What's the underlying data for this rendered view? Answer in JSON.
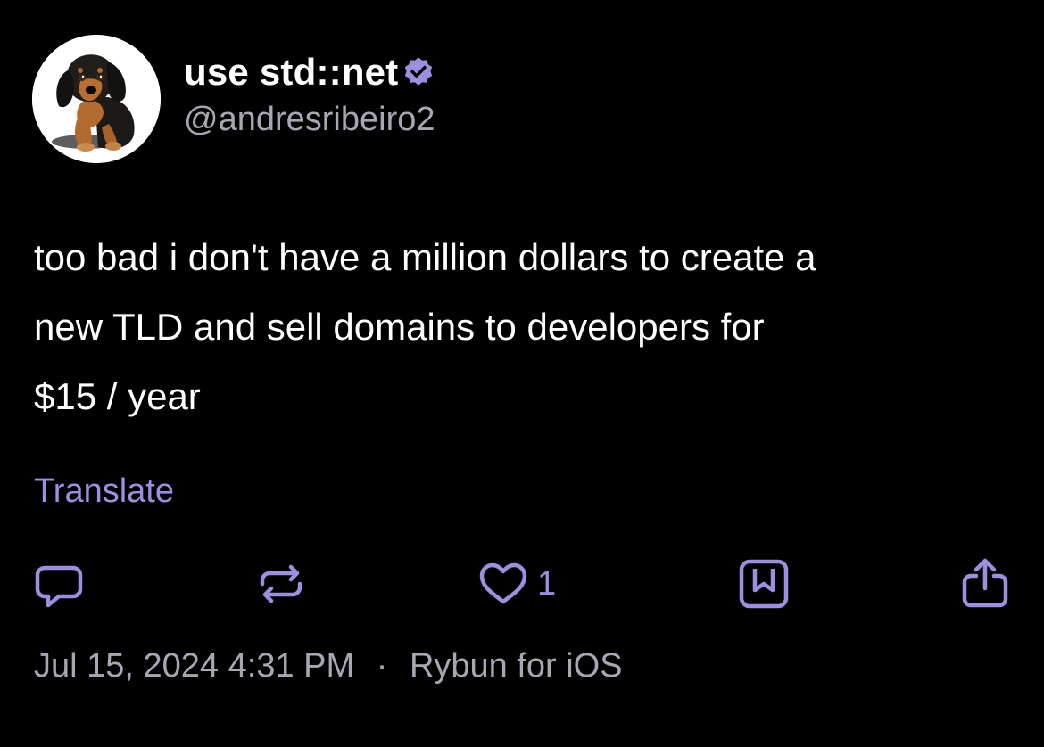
{
  "post": {
    "author": {
      "display_name": "use std::net",
      "handle": "@andresribeiro2",
      "verified": true,
      "avatar_icon": "dachshund-puppy-avatar"
    },
    "text_lines": [
      "too bad i don't have a million dollars to create a",
      "new TLD and sell domains to developers for",
      "$15 / year"
    ],
    "translate_label": "Translate",
    "actions": {
      "reply_icon": "chat-bubble-icon",
      "repost_icon": "repost-arrows-icon",
      "like_icon": "heart-icon",
      "like_count": "1",
      "bookmark_icon": "bookmark-icon",
      "share_icon": "share-icon"
    },
    "meta": {
      "date": "Jul 15, 2024",
      "time": "4:31 PM",
      "separator": "·",
      "client": "Rybun for iOS"
    }
  },
  "colors": {
    "background": "#000000",
    "text": "#ffffff",
    "secondary_text": "#a7a7b3",
    "accent": "#9e8fde"
  }
}
